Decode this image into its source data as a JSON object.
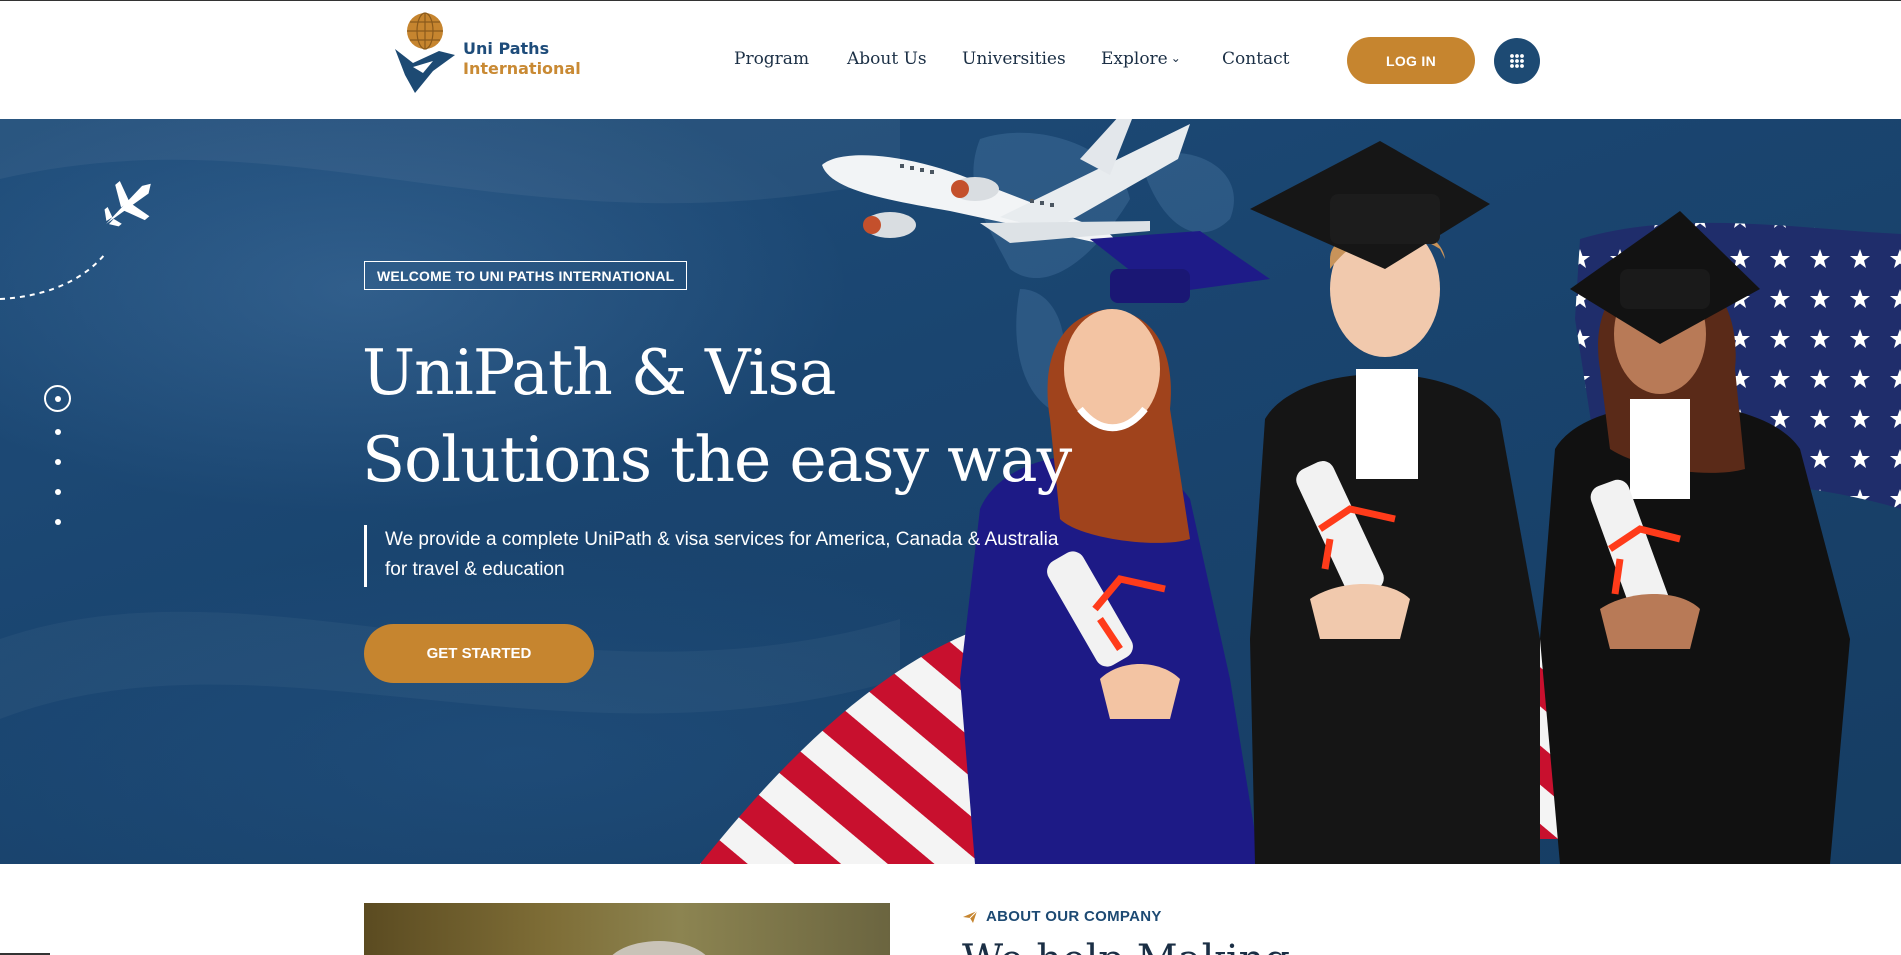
{
  "brand": {
    "name_line1": "Uni Paths",
    "name_line2": "International",
    "colors": {
      "navy": "#1d4a73",
      "gold": "#c6852f"
    }
  },
  "nav": {
    "items": [
      {
        "label": "Program"
      },
      {
        "label": "About Us"
      },
      {
        "label": "Universities"
      },
      {
        "label": "Explore",
        "has_dropdown": true
      },
      {
        "label": "Contact"
      }
    ],
    "login_label": "LOG IN",
    "menu_icon": "grid-icon"
  },
  "hero": {
    "badge": "WELCOME TO UNI PATHS INTERNATIONAL",
    "title_line1": "UniPath & Visa",
    "title_line2": "Solutions the easy way",
    "description": "We provide a complete UniPath & visa services for America, Canada & Australia for travel & education",
    "cta_label": "GET STARTED",
    "slider": {
      "total": 5,
      "active": 1
    }
  },
  "about": {
    "kicker": "ABOUT OUR COMPANY",
    "heading_peek": "We help Making"
  }
}
